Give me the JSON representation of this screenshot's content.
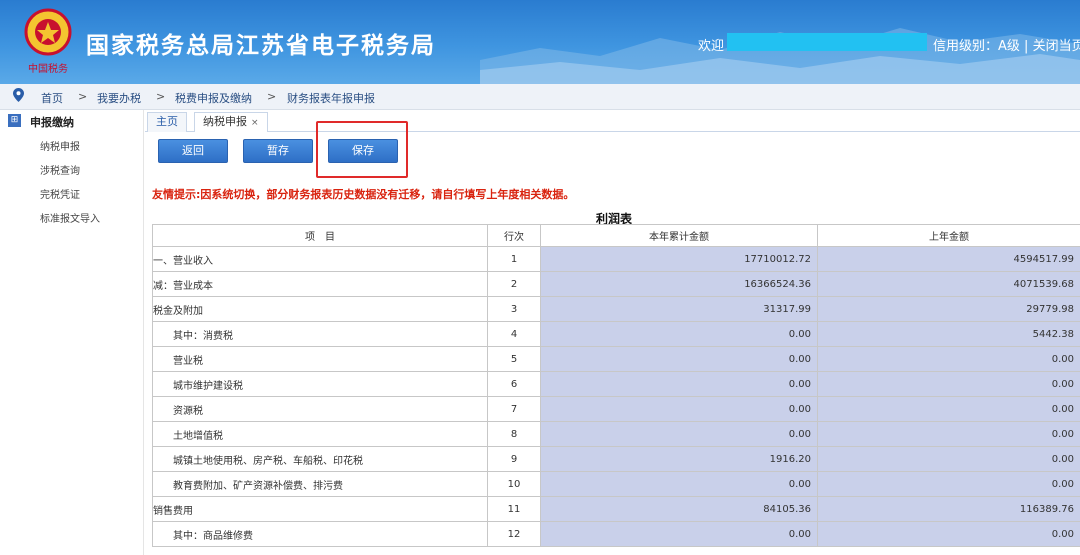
{
  "header": {
    "site_title": "国家税务总局江苏省电子税务局",
    "logo_caption": "中国税务",
    "welcome": "欢迎",
    "credit_level": "信用级别：A级",
    "close_link": "关闭当页"
  },
  "breadcrumb": {
    "items": [
      "首页",
      "我要办税",
      "税费申报及缴纳",
      "财务报表年报申报"
    ],
    "separator": ">"
  },
  "sidebar": {
    "section": "申报缴纳",
    "items": [
      "纳税申报",
      "涉税查询",
      "完税凭证",
      "标准报文导入"
    ]
  },
  "tabs": [
    {
      "label": "主页"
    },
    {
      "label": "纳税申报",
      "close": "×"
    }
  ],
  "toolbar": {
    "back_label": "返回",
    "draft_label": "暂存",
    "save_label": "保存"
  },
  "tip": "友情提示:因系统切换，部分财务报表历史数据没有迁移，请自行填写上年度相关数据。",
  "table": {
    "title": "利润表",
    "headers": [
      "项　目",
      "行次",
      "本年累计金额",
      "上年金额"
    ],
    "rows": [
      {
        "name": "一、营业收入",
        "line": "1",
        "current": "17710012.72",
        "previous": "4594517.99"
      },
      {
        "name": "减：营业成本",
        "line": "2",
        "current": "16366524.36",
        "previous": "4071539.68"
      },
      {
        "name": "税金及附加",
        "line": "3",
        "current": "31317.99",
        "previous": "29779.98"
      },
      {
        "name": "其中：消费税",
        "line": "4",
        "current": "0.00",
        "previous": "5442.38"
      },
      {
        "name": "营业税",
        "line": "5",
        "current": "0.00",
        "previous": "0.00"
      },
      {
        "name": "城市维护建设税",
        "line": "6",
        "current": "0.00",
        "previous": "0.00"
      },
      {
        "name": "资源税",
        "line": "7",
        "current": "0.00",
        "previous": "0.00"
      },
      {
        "name": "土地增值税",
        "line": "8",
        "current": "0.00",
        "previous": "0.00"
      },
      {
        "name": "城镇土地使用税、房产税、车船税、印花税",
        "line": "9",
        "current": "1916.20",
        "previous": "0.00"
      },
      {
        "name": "教育费附加、矿产资源补偿费、排污费",
        "line": "10",
        "current": "0.00",
        "previous": "0.00"
      },
      {
        "name": "销售费用",
        "line": "11",
        "current": "84105.36",
        "previous": "116389.76"
      },
      {
        "name": "其中：商品维修费",
        "line": "12",
        "current": "0.00",
        "previous": "0.00"
      }
    ]
  },
  "colors": {
    "header_blue": "#2a7cd0",
    "button_blue": "#2e6fc6",
    "value_cell_bg": "#c9d0ea",
    "tip_red": "#d9230f",
    "highlight_red": "#e02a2a"
  }
}
